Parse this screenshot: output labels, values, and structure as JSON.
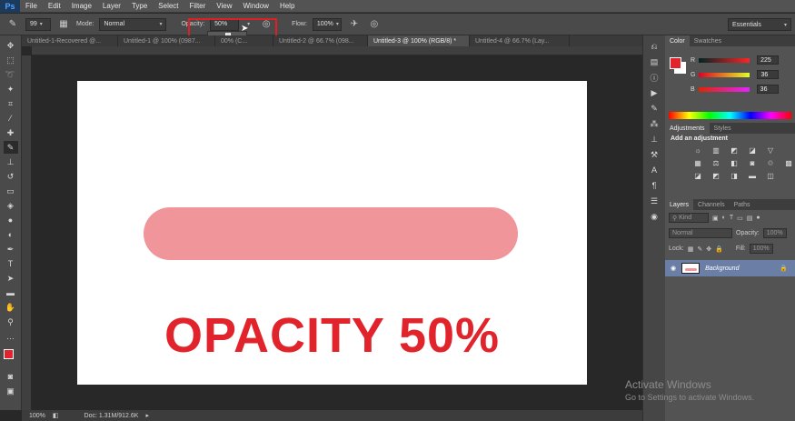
{
  "app": {
    "logo": "Ps"
  },
  "menu": [
    "File",
    "Edit",
    "Image",
    "Layer",
    "Type",
    "Select",
    "Filter",
    "View",
    "Window",
    "Help"
  ],
  "options": {
    "brush_size": "99",
    "mode_label": "Mode:",
    "mode_value": "Normal",
    "opacity_label": "Opacity:",
    "opacity_value": "50%",
    "opacity_slider_level": 0.5,
    "flow_label": "Flow:",
    "flow_value": "100%",
    "workspace": "Essentials"
  },
  "tabs": [
    "Untitled-1-Recovered @...",
    "Untitled-1 @ 100% (0987...",
    "00% (C...",
    "Untitled-2 @ 66.7% (098...",
    "Untitled-3 @ 100% (RGB/8) *",
    "Untitled-4 @ 66.7% (Lay..."
  ],
  "canvas": {
    "text": "OPACITY 50%",
    "text_color": "#e1242b",
    "stroke_color": "#f0959a"
  },
  "status": {
    "zoom": "100%",
    "doc": "Doc: 1.31M/912.6K"
  },
  "color_panel": {
    "tabs": [
      "Color",
      "Swatches"
    ],
    "r_label": "R",
    "r_value": "225",
    "g_label": "G",
    "g_value": "36",
    "b_label": "B",
    "b_value": "36",
    "foreground": "#e1242b"
  },
  "adjustments": {
    "tabs": [
      "Adjustments",
      "Styles"
    ],
    "title": "Add an adjustment"
  },
  "layers": {
    "tabs": [
      "Layers",
      "Channels",
      "Paths"
    ],
    "kind_label": "Kind",
    "blend_mode": "Normal",
    "opacity_label": "Opacity:",
    "opacity_value": "100%",
    "lock_label": "Lock:",
    "fill_label": "Fill:",
    "fill_value": "100%",
    "layer_name": "Background"
  },
  "watermark": {
    "line1": "Activate Windows",
    "line2": "Go to Settings to activate Windows."
  }
}
